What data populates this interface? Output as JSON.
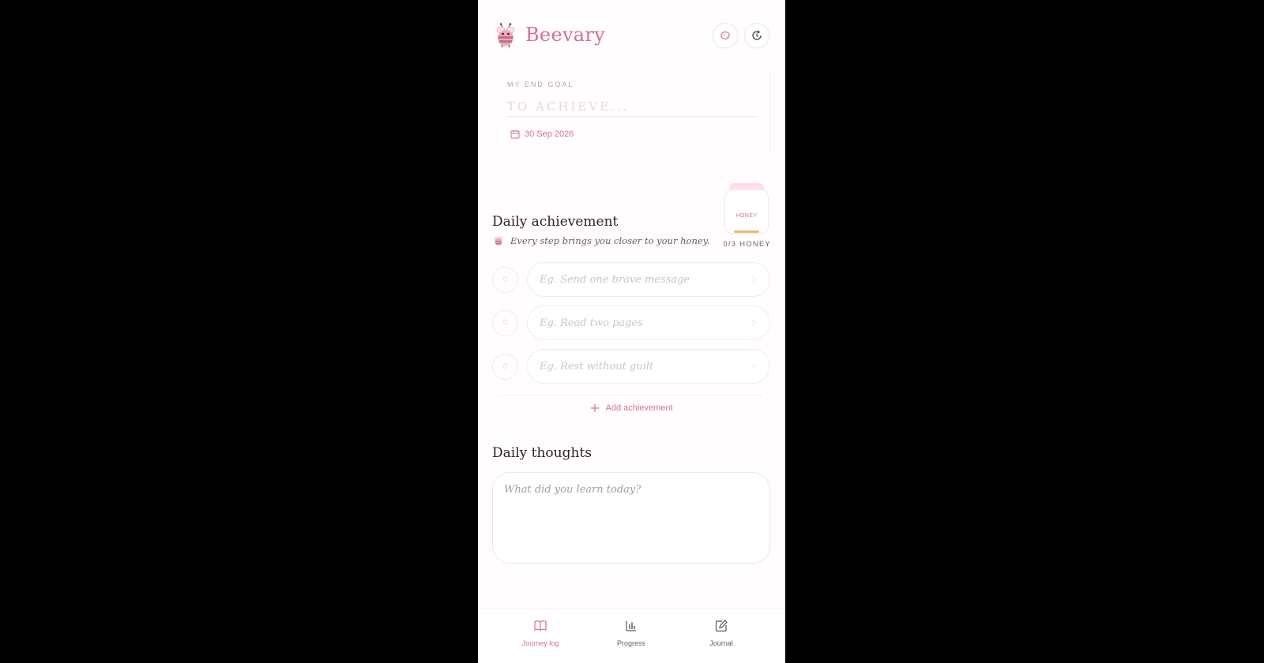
{
  "app": {
    "brand": "Beevary"
  },
  "goal": {
    "label": "MY END GOAL",
    "placeholder": "TO ACHIEVE...",
    "date": "30 Sep 2026"
  },
  "honey": {
    "jar_label": "HONEY",
    "count": "0/3 HONEY",
    "filled": 0,
    "total": 3
  },
  "achievement": {
    "title": "Daily achievement",
    "subtitle": "Every step brings you closer to your honey.",
    "items": [
      {
        "placeholder": "Eg. Send one brave message",
        "count": "0"
      },
      {
        "placeholder": "Eg. Read two pages",
        "count": "0"
      },
      {
        "placeholder": "Eg. Rest without guilt",
        "count": "0"
      }
    ],
    "add_label": "Add achievement"
  },
  "thoughts": {
    "title": "Daily thoughts",
    "placeholder": "What did you learn today?"
  },
  "nav": [
    {
      "label": "Journey log",
      "icon": "book-icon",
      "active": true
    },
    {
      "label": "Progress",
      "icon": "bar-chart-icon",
      "active": false
    },
    {
      "label": "Journal",
      "icon": "edit-icon",
      "active": false
    }
  ],
  "colors": {
    "accent": "#d96f8c",
    "honey": "#f1b86a",
    "background": "#fffdfd"
  }
}
